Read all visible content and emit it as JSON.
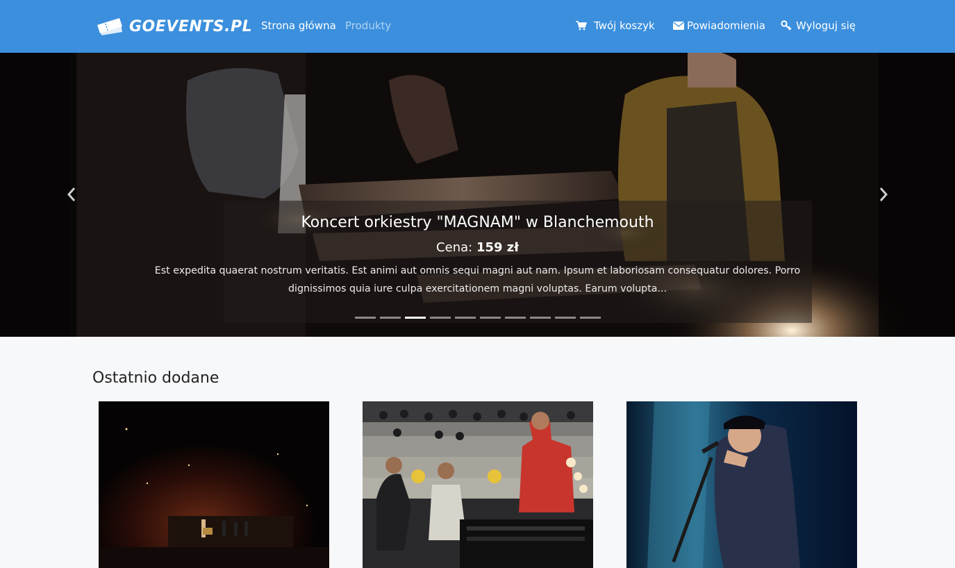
{
  "nav": {
    "brand": "GOEVENTS.PL",
    "links": [
      {
        "label": "Strona główna",
        "active": true
      },
      {
        "label": "Produkty",
        "active": false
      }
    ],
    "right": [
      {
        "label": "Twój koszyk",
        "icon": "cart-icon"
      },
      {
        "label": "Powiadomienia",
        "icon": "envelope-icon"
      },
      {
        "label": "Wyloguj się",
        "icon": "key-icon"
      }
    ]
  },
  "carousel": {
    "title": "Koncert orkiestry \"MAGNAM\" w Blanchemouth",
    "price_label": "Cena:",
    "price_value": "159 zł",
    "description": "Est expedita quaerat nostrum veritatis. Est animi aut omnis sequi magni aut nam. Ipsum et laboriosam consequatur dolores. Porro dignissimos quia iure culpa exercitationem magni voluptas. Earum volupta...",
    "slide_count": 10,
    "active_slide": 2
  },
  "recent": {
    "title": "Ostatnio dodane",
    "cards": [
      {
        "image": "concert-stage-photo"
      },
      {
        "image": "sound-crew-photo"
      },
      {
        "image": "singer-microphone-photo"
      }
    ]
  },
  "colors": {
    "navbar": "#3b8fdd",
    "page_background": "#f7f8fa"
  }
}
